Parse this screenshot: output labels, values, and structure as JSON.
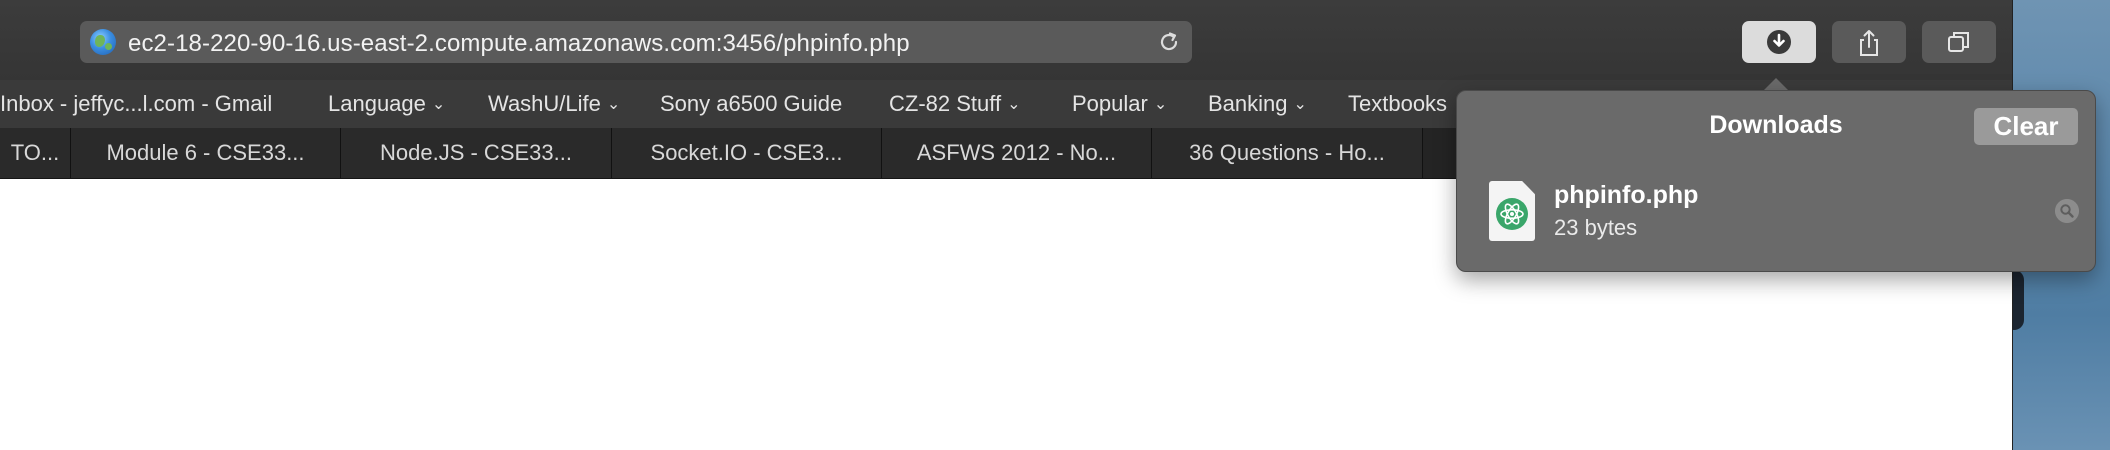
{
  "address_bar": {
    "url": "ec2-18-220-90-16.us-east-2.compute.amazonaws.com:3456/phpinfo.php",
    "site_icon": "globe-icon",
    "reload_icon": "reload-icon"
  },
  "toolbar": {
    "downloads_icon": "download-arrow-icon",
    "share_icon": "share-icon",
    "tabs_icon": "tab-overview-icon"
  },
  "bookmarks": [
    {
      "label": "Inbox - jeffyc...l.com - Gmail",
      "has_menu": false
    },
    {
      "label": "Language",
      "has_menu": true
    },
    {
      "label": "WashU/Life",
      "has_menu": true
    },
    {
      "label": "Sony a6500 Guide",
      "has_menu": false
    },
    {
      "label": "CZ-82 Stuff",
      "has_menu": true
    },
    {
      "label": "Popular",
      "has_menu": true
    },
    {
      "label": "Banking",
      "has_menu": true
    },
    {
      "label": "Textbooks",
      "has_menu": false
    }
  ],
  "tabs": [
    {
      "label": "TO..."
    },
    {
      "label": "Module 6 - CSE33..."
    },
    {
      "label": "Node.JS - CSE33..."
    },
    {
      "label": "Socket.IO - CSE3..."
    },
    {
      "label": "ASFWS 2012 - No..."
    },
    {
      "label": "36 Questions - Ho..."
    }
  ],
  "downloads_popover": {
    "title": "Downloads",
    "clear_label": "Clear",
    "items": [
      {
        "name": "phpinfo.php",
        "size": "23 bytes",
        "icon": "atom-file-icon",
        "reveal_icon": "magnifier-icon"
      }
    ]
  },
  "colors": {
    "toolbar_bg": "#3c3c3c",
    "popover_bg": "#6a6a6a",
    "desktop_bg": "#5d87a8"
  }
}
